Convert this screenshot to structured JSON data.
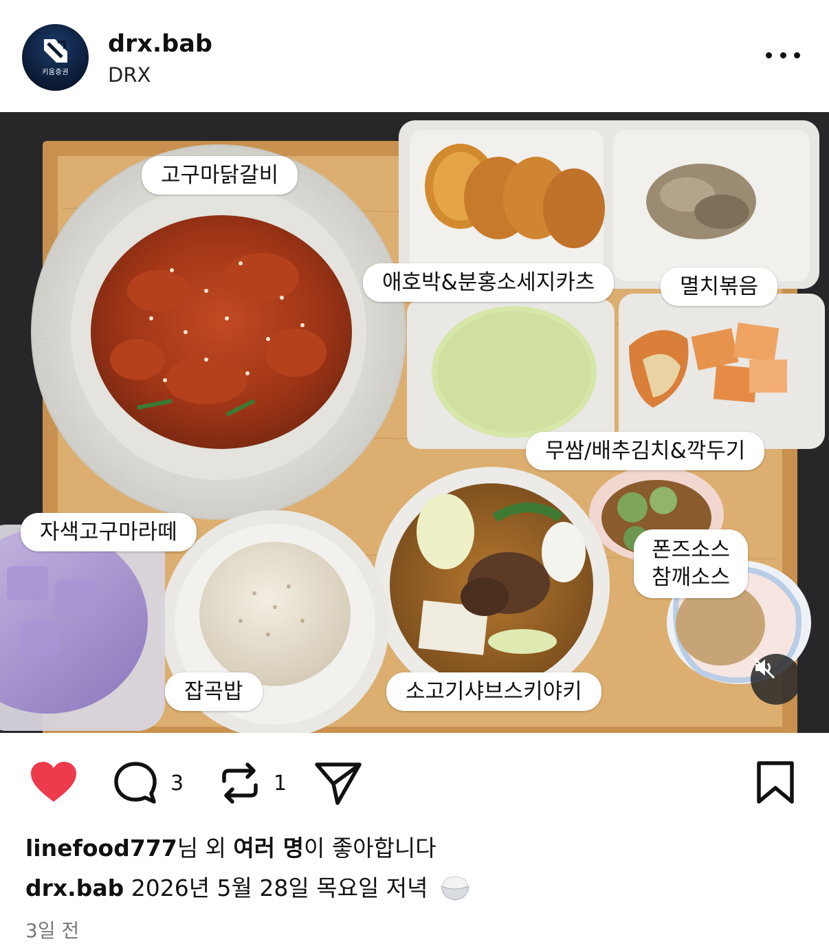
{
  "post": {
    "username": "drx.bab",
    "display_name": "DRX",
    "avatar_text": "키움증권"
  },
  "photo_labels": {
    "main_dish": "고구마닭갈비",
    "side_1": "애호박&분홍소세지카츠",
    "side_2": "멸치볶음",
    "side_3": "무쌈/배추김치&깍두기",
    "drink": "자색고구마라떼",
    "rice": "잡곡밥",
    "soup": "소고기샤브스키야키",
    "sauce_1": "폰즈소스",
    "sauce_2": "참깨소스"
  },
  "actions": {
    "comment_count": "3",
    "repost_count": "1",
    "liked": true
  },
  "likes": {
    "user": "linefood777",
    "suffix_1": "님 외 ",
    "bold": "여러 명",
    "suffix_2": "이 좋아합니다"
  },
  "caption": {
    "username": "drx.bab",
    "text": " 2026년 5월 28일 목요일 저녁 "
  },
  "timestamp": "3일 전",
  "colors": {
    "heart": "#ed3b4b",
    "tray": "#d9a766",
    "background_table": "#2c2c2e"
  }
}
